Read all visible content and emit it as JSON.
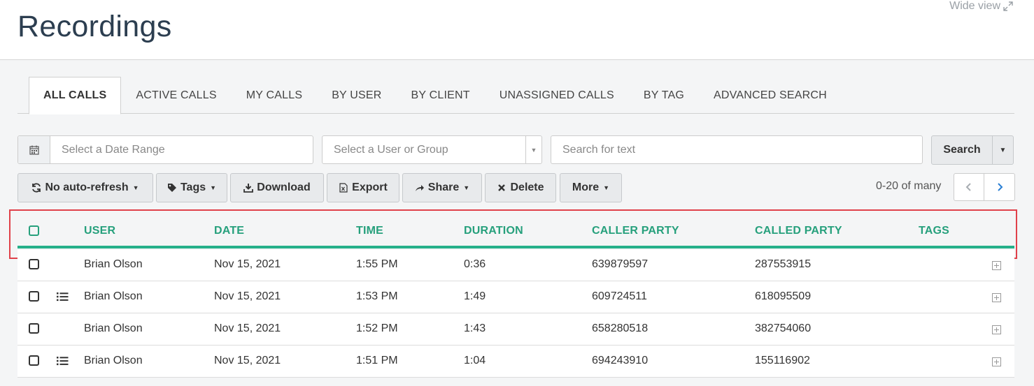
{
  "header": {
    "title": "Recordings",
    "wide_view_label": "Wide view"
  },
  "tabs": [
    {
      "label": "ALL CALLS",
      "active": true
    },
    {
      "label": "ACTIVE CALLS",
      "active": false
    },
    {
      "label": "MY CALLS",
      "active": false
    },
    {
      "label": "BY USER",
      "active": false
    },
    {
      "label": "BY CLIENT",
      "active": false
    },
    {
      "label": "UNASSIGNED CALLS",
      "active": false
    },
    {
      "label": "BY TAG",
      "active": false
    },
    {
      "label": "ADVANCED SEARCH",
      "active": false
    }
  ],
  "filters": {
    "date_placeholder": "Select a Date Range",
    "user_placeholder": "Select a User or Group",
    "text_placeholder": "Search for text",
    "search_label": "Search"
  },
  "toolbar": {
    "auto_refresh_label": "No auto-refresh",
    "tags_label": "Tags",
    "download_label": "Download",
    "export_label": "Export",
    "share_label": "Share",
    "delete_label": "Delete",
    "more_label": "More"
  },
  "pagination": {
    "text": "0-20 of many"
  },
  "table": {
    "columns": {
      "user": "USER",
      "date": "DATE",
      "time": "TIME",
      "duration": "DURATION",
      "caller": "CALLER PARTY",
      "called": "CALLED PARTY",
      "tags": "TAGS"
    },
    "rows": [
      {
        "user": "Brian Olson",
        "date": "Nov 15, 2021",
        "time": "1:55 PM",
        "duration": "0:36",
        "caller": "639879597",
        "called": "287553915",
        "has_notes": false
      },
      {
        "user": "Brian Olson",
        "date": "Nov 15, 2021",
        "time": "1:53 PM",
        "duration": "1:49",
        "caller": "609724511",
        "called": "618095509",
        "has_notes": true
      },
      {
        "user": "Brian Olson",
        "date": "Nov 15, 2021",
        "time": "1:52 PM",
        "duration": "1:43",
        "caller": "658280518",
        "called": "382754060",
        "has_notes": false
      },
      {
        "user": "Brian Olson",
        "date": "Nov 15, 2021",
        "time": "1:51 PM",
        "duration": "1:04",
        "caller": "694243910",
        "called": "155116902",
        "has_notes": true
      }
    ]
  },
  "colors": {
    "accent": "#26a07c",
    "highlight": "#e0414a",
    "pager_arrow_active": "#2a7fd4"
  }
}
